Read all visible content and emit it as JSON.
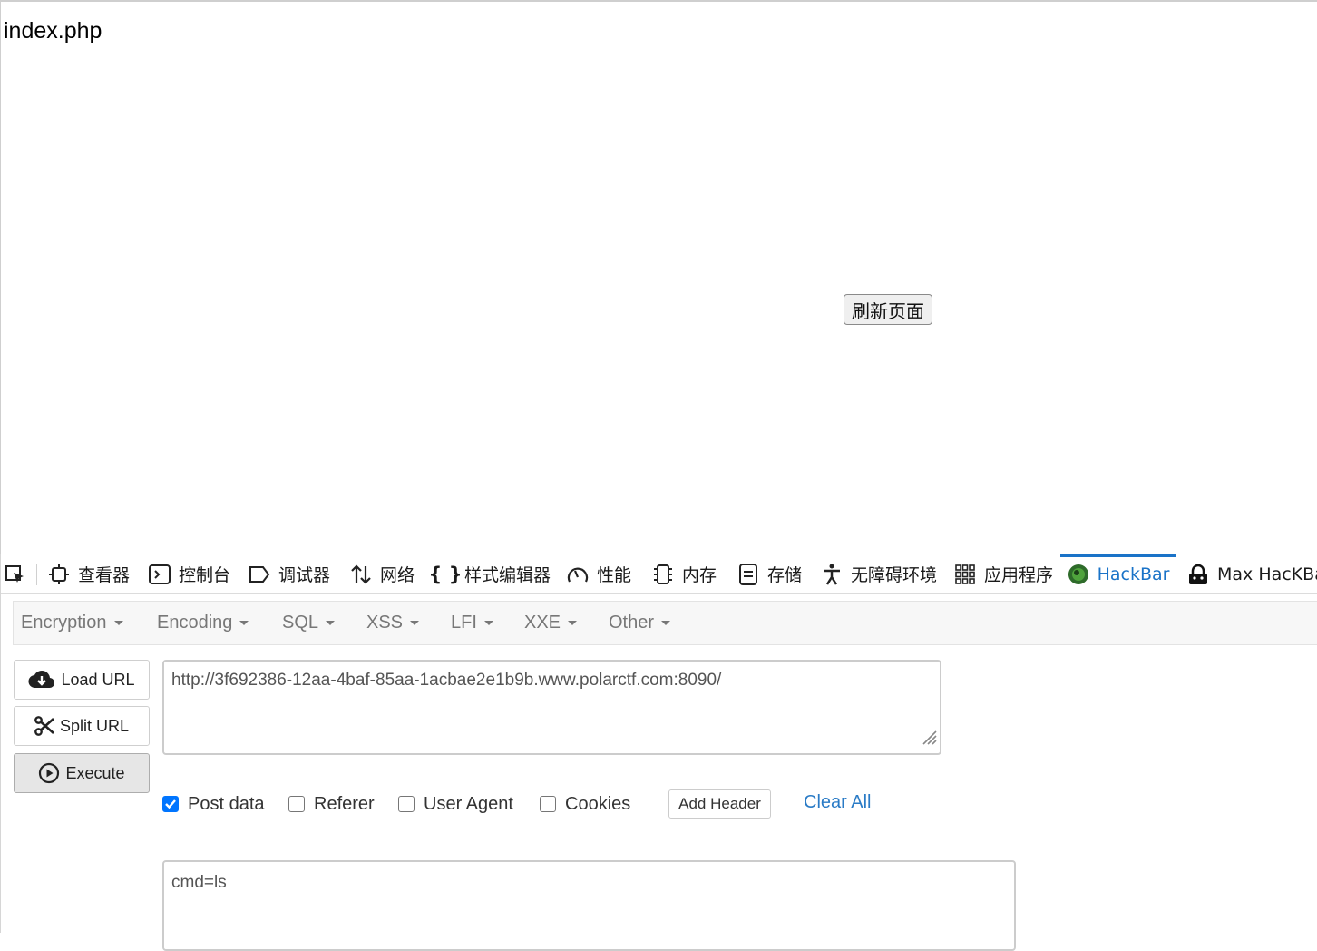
{
  "page": {
    "text": "index.php",
    "refresh_button": "刷新页面"
  },
  "devtools": {
    "tabs": [
      {
        "label": "查看器",
        "icon": "inspector-icon"
      },
      {
        "label": "控制台",
        "icon": "console-icon"
      },
      {
        "label": "调试器",
        "icon": "debugger-icon"
      },
      {
        "label": "网络",
        "icon": "network-icon"
      },
      {
        "label": "样式编辑器",
        "icon": "style-editor-icon"
      },
      {
        "label": "性能",
        "icon": "performance-icon"
      },
      {
        "label": "内存",
        "icon": "memory-icon"
      },
      {
        "label": "存储",
        "icon": "storage-icon"
      },
      {
        "label": "无障碍环境",
        "icon": "accessibility-icon"
      },
      {
        "label": "应用程序",
        "icon": "application-icon"
      },
      {
        "label": "HackBar",
        "icon": "hackbar-icon",
        "active": true
      },
      {
        "label": "Max HacKBar",
        "icon": "max-hackbar-icon"
      }
    ],
    "active_color": "#1a73c8"
  },
  "hackbar": {
    "menus": [
      "Encryption",
      "Encoding",
      "SQL",
      "XSS",
      "LFI",
      "XXE",
      "Other"
    ],
    "load_url": "Load URL",
    "split_url": "Split URL",
    "execute": "Execute",
    "url_value": "http://3f692386-12aa-4baf-85aa-1acbae2e1b9b.www.polarctf.com:8090/",
    "options": {
      "post_data": {
        "label": "Post data",
        "checked": true
      },
      "referer": {
        "label": "Referer",
        "checked": false
      },
      "user_agent": {
        "label": "User Agent",
        "checked": false
      },
      "cookies": {
        "label": "Cookies",
        "checked": false
      }
    },
    "add_header": "Add Header",
    "clear_all": "Clear All",
    "post_value": "cmd=ls"
  }
}
